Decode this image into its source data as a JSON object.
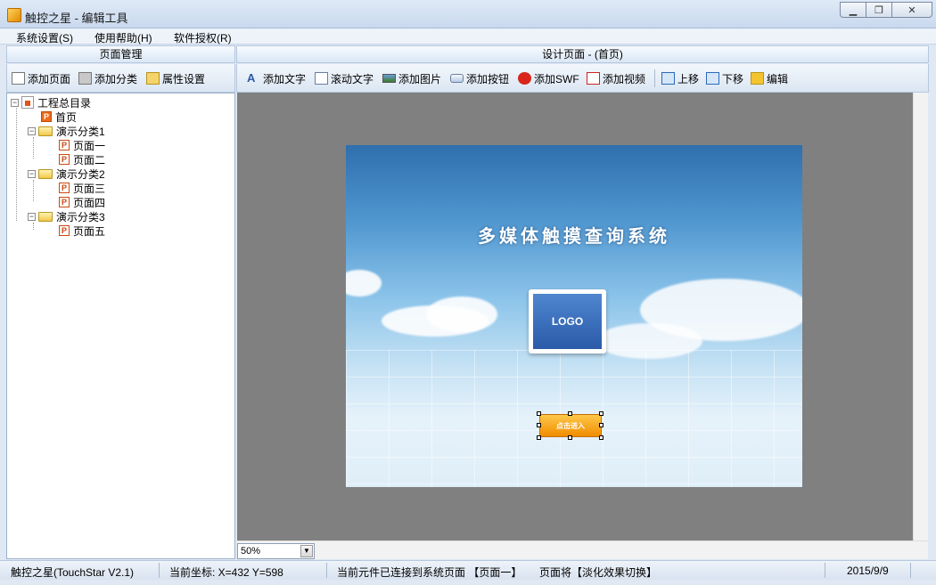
{
  "window": {
    "title": "触控之星 - 编辑工具"
  },
  "menu": [
    {
      "label": "系统设置(S)"
    },
    {
      "label": "使用帮助(H)"
    },
    {
      "label": "软件授权(R)"
    }
  ],
  "left_panel": {
    "header": "页面管理",
    "toolbar": [
      {
        "label": "添加页面",
        "icon": "add-page-icon"
      },
      {
        "label": "添加分类",
        "icon": "add-category-icon"
      },
      {
        "label": "属性设置",
        "icon": "properties-icon"
      }
    ],
    "tree": {
      "root": "工程总目录",
      "home": "首页",
      "categories": [
        {
          "label": "演示分类1",
          "pages": [
            "页面一",
            "页面二"
          ]
        },
        {
          "label": "演示分类2",
          "pages": [
            "页面三",
            "页面四"
          ]
        },
        {
          "label": "演示分类3",
          "pages": [
            "页面五"
          ]
        }
      ]
    }
  },
  "right_panel": {
    "header": "设计页面 - (首页)",
    "toolbar": [
      {
        "label": "添加文字",
        "icon": "add-text-icon"
      },
      {
        "label": "滚动文字",
        "icon": "scroll-text-icon"
      },
      {
        "label": "添加图片",
        "icon": "add-image-icon"
      },
      {
        "label": "添加按钮",
        "icon": "add-button-icon"
      },
      {
        "label": "添加SWF",
        "icon": "add-swf-icon"
      },
      {
        "label": "添加视频",
        "icon": "add-video-icon"
      },
      {
        "label": "上移",
        "icon": "move-up-icon"
      },
      {
        "label": "下移",
        "icon": "move-down-icon"
      },
      {
        "label": "编辑",
        "icon": "edit-icon"
      }
    ],
    "canvas": {
      "title": "多媒体触摸查询系统",
      "logo": "LOGO",
      "enter_button": "点击进入"
    },
    "zoom": "50%"
  },
  "status": {
    "app": "触控之星(TouchStar V2.1)",
    "coords": "当前坐标: X=432 Y=598",
    "link": "当前元件已连接到系统页面 【页面一】",
    "effect": "页面将【淡化效果切换】",
    "date": "2015/9/9"
  },
  "colors": {
    "accent": "#2a5aa8",
    "button": "#f08c00",
    "workspace": "#808080"
  }
}
